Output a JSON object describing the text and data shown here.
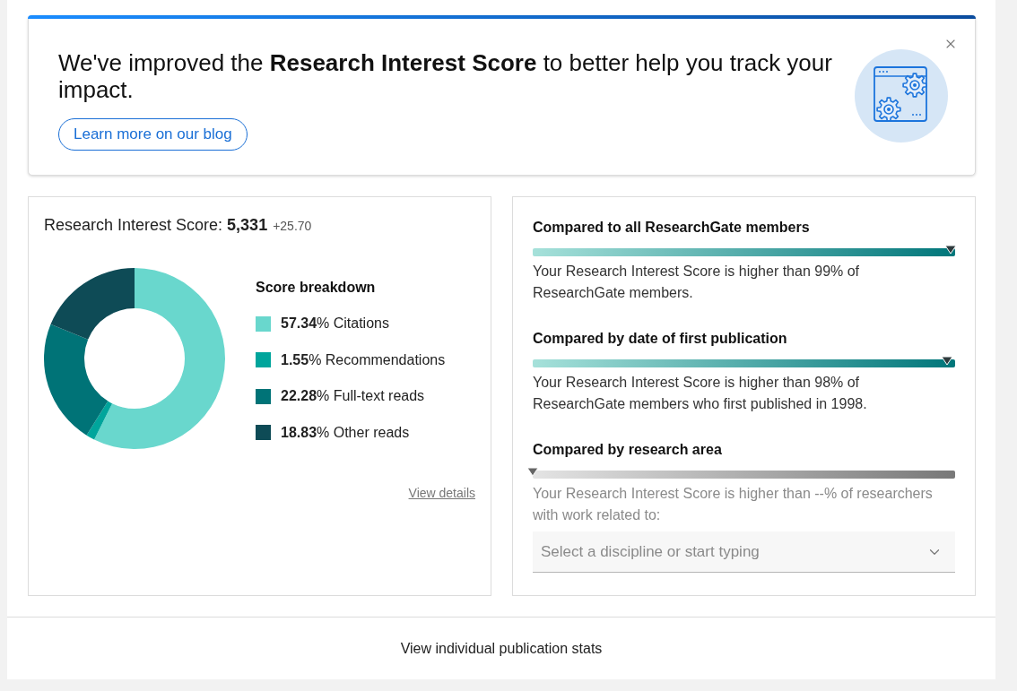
{
  "banner": {
    "headline": "We've improved the **Research Interest Score** to better help you track your impact.",
    "button": "Learn more on our blog"
  },
  "score_card": {
    "label": "Research Interest Score: **5,331**",
    "change": "+25.70",
    "chart_data": {
      "type": "donut",
      "categories": [
        "Citations",
        "Recommendations",
        "Full-text reads",
        "Other reads"
      ],
      "values": [
        57.34,
        1.55,
        22.28,
        18.83
      ]
    },
    "breakdown_title": "Score breakdown",
    "legend": [
      {
        "share": "**57.34**%",
        "color": "#69d7cd"
      },
      {
        "share": "**1.55**%",
        "color": "#00a59c"
      },
      {
        "share": "**22.28**%",
        "color": "#007377"
      },
      {
        "share": "**18.83**%",
        "color": "#0e4b56"
      }
    ],
    "details_link": "View details"
  },
  "comparison_card": {
    "sections": [
      {
        "title": "Compared to all ResearchGate members",
        "level": 0.99,
        "disabled": false,
        "description": "Your Research Interest Score is higher than 99% of ResearchGate members."
      },
      {
        "title": "Compared by date of first publication",
        "level": 0.98,
        "disabled": false,
        "description": "Your Research Interest Score is higher than 98% of ResearchGate members who first published in 1998."
      },
      {
        "title": "Compared by research area",
        "level": 0,
        "disabled": true,
        "description": "Your Research Interest Score is higher than --% of researchers with work related to:",
        "select": {
          "placeholder": "Select a discipline or start typing"
        }
      }
    ]
  },
  "footer": {
    "link": "View individual publication stats"
  }
}
